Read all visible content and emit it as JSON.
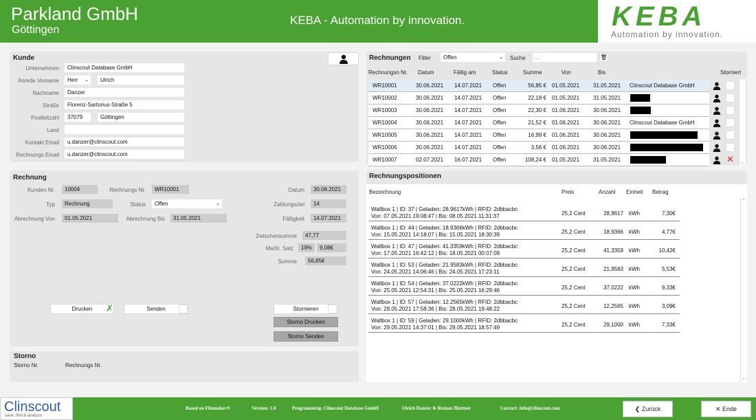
{
  "header": {
    "company": "Parkland GmbH",
    "city": "Göttingen",
    "tagline": "KEBA - Automation by innovation.",
    "logo_text": "KEBA",
    "logo_sub": "Automation by innovation."
  },
  "kunde": {
    "title": "Kunde",
    "unternehmen_label": "Unternehmen",
    "unternehmen": "Clinscout Database GmbH",
    "anrede_label": "Anrede Vorname",
    "anrede": "Herr",
    "vorname": "Ulrich",
    "nachname_label": "Nachname",
    "nachname": "Danzer",
    "strasse_label": "Straße",
    "strasse": "Florenz-Sartorius-Straße 5",
    "plz_label": "Postleitzahl",
    "plz": "37079",
    "ort": "Göttingen",
    "land_label": "Land",
    "land": "",
    "kontakt_label": "Kontakt Email",
    "kontakt": "u.danzer@clinscout.com",
    "rechnung_email_label": "Rechnungs Email",
    "rechnung_email": "u.danzer@clinscout.com"
  },
  "rechnung": {
    "title": "Rechnung",
    "kunden_nr_label": "Kunden Nr.",
    "kunden_nr": "10004",
    "rechnungs_nr_label": "Rechnungs Nr.",
    "rechnungs_nr": "WR10001",
    "datum_label": "Datum",
    "datum": "30.06.2021",
    "typ_label": "Typ",
    "typ": "Rechnung",
    "status_label": "Status",
    "status": "Offen",
    "zahlungsziel_label": "Zahlungsziel",
    "zahlungsziel": "14",
    "abrechnung_von_label": "Abrechnung Von",
    "abrechnung_von": "01.05.2021",
    "abrechnung_bis_label": "Abrechnung Bis",
    "abrechnung_bis": "31.05.2021",
    "faelligkeit_label": "Fälligkeit",
    "faelligkeit": "14.07.2021",
    "zwischensumme_label": "Zwischensumme",
    "zwischensumme": "47,77",
    "mwst_label": "MwSt. Satz",
    "mwst_satz": "19%",
    "mwst_betrag": "9,08€",
    "summe_label": "Summe",
    "summe": "56,85€",
    "drucken": "Drucken",
    "senden": "Senden",
    "stornieren": "Stornieren",
    "storno_drucken": "Storno Drucken",
    "storno_senden": "Storno Senden"
  },
  "storno": {
    "title": "Storno",
    "storno_nr": "Storno Nr.",
    "rechnungs_nr": "Rechnungs Nr."
  },
  "rechnungen": {
    "title": "Rechnungen",
    "filter_label": "Filter",
    "filter_value": "Offen",
    "suche_label": "Suche",
    "suche_placeholder": "...",
    "headers": {
      "nr": "Rechnungsn Nr.",
      "datum": "Datum",
      "faellig": "Fällig am",
      "status": "Status",
      "summe": "Summe",
      "von": "Von",
      "bis": "Bis",
      "storniert": "Storniert"
    },
    "rows": [
      {
        "nr": "WR10001",
        "datum": "30.06.2021",
        "faellig": "14.07.2021",
        "status": "Offen",
        "summe": "56,85 €",
        "von": "01.05.2021",
        "bis": "31.05.2021",
        "kunde": "Clinscout Database GmbH",
        "redact": 0,
        "storniert": false
      },
      {
        "nr": "WR10002",
        "datum": "30.06.2021",
        "faellig": "14.07.2021",
        "status": "Offen",
        "summe": "22,18 €",
        "von": "01.05.2021",
        "bis": "31.05.2021",
        "kunde": "",
        "redact": 29,
        "storniert": false
      },
      {
        "nr": "WR10003",
        "datum": "30.06.2021",
        "faellig": "14.07.2021",
        "status": "Offen",
        "summe": "22,30 €",
        "von": "01.06.2021",
        "bis": "30.06.2021",
        "kunde": "",
        "redact": 30,
        "storniert": false
      },
      {
        "nr": "WR10004",
        "datum": "30.06.2021",
        "faellig": "14.07.2021",
        "status": "Offen",
        "summe": "21,52 €",
        "von": "01.06.2021",
        "bis": "30.06.2021",
        "kunde": "Clinscout Database GmbH",
        "redact": 0,
        "storniert": false
      },
      {
        "nr": "WR10005",
        "datum": "30.06.2021",
        "faellig": "14.07.2021",
        "status": "Offen",
        "summe": "16,99 €",
        "von": "01.06.2021",
        "bis": "30.06.2021",
        "kunde": "",
        "redact": 98,
        "storniert": false
      },
      {
        "nr": "WR10006",
        "datum": "30.06.2021",
        "faellig": "14.07.2021",
        "status": "Offen",
        "summe": "3,56 €",
        "von": "01.06.2021",
        "bis": "30.06.2021",
        "kunde": "",
        "redact": 106,
        "storniert": false
      },
      {
        "nr": "WR10007",
        "datum": "02.07.2021",
        "faellig": "16.07.2021",
        "status": "Offen",
        "summe": "108,24 €",
        "von": "01.05.2021",
        "bis": "31.05.2021",
        "kunde": "",
        "redact": 52,
        "storniert": true
      }
    ]
  },
  "positionen": {
    "title": "Rechnungspositionen",
    "headers": {
      "bezeichnung": "Bezeichnung",
      "preis": "Preis",
      "anzahl": "Anzahl",
      "einheit": "Einheit",
      "betrag": "Betrag"
    },
    "rows": [
      {
        "l1": "Wallbox 1 | ID: 37 | Geladen: 28.9617kWh | RFID: 2dbbacbc",
        "l2": "Von: 07.05.2021 19:08:47 | Bis: 08.05.2021 11:31:37",
        "preis": "25,2 Cent",
        "anzahl": "28,9617",
        "einheit": "kWh",
        "betrag": "7,30€"
      },
      {
        "l1": "Wallbox 1 | ID: 44 | Geladen: 18.9366kWh | RFID: 2dbbacbc",
        "l2": "Von: 15.05.2021 14:18:07 | Bis: 15.05.2021 18:30:39",
        "preis": "25,2 Cent",
        "anzahl": "18,9366",
        "einheit": "kWh",
        "betrag": "4,77€"
      },
      {
        "l1": "Wallbox 1 | ID: 47 | Geladen: 41.3359kWh | RFID: 2dbbacbc",
        "l2": "Von: 17.05.2021 16:42:12 | Bis: 18.05.2021 00:07:09",
        "preis": "25,2 Cent",
        "anzahl": "41,3359",
        "einheit": "kWh",
        "betrag": "10,42€"
      },
      {
        "l1": "Wallbox 1 | ID: 53 | Geladen: 21.9583kWh | RFID: 2dbbacbc",
        "l2": "Von: 24.05.2021 14:06:46 | Bis: 24.05.2021 17:23:11",
        "preis": "25,2 Cent",
        "anzahl": "21,9583",
        "einheit": "kWh",
        "betrag": "5,53€"
      },
      {
        "l1": "Wallbox 1 | ID: 54 | Geladen: 37.0222kWh | RFID: 2dbbacbc",
        "l2": "Von: 25.05.2021 12:54:31 | Bis: 25.05.2021 16:29:46",
        "preis": "25,2 Cent",
        "anzahl": "37,0222",
        "einheit": "kWh",
        "betrag": "9,33€"
      },
      {
        "l1": "Wallbox 1 | ID: 57 | Geladen: 12.2565kWh | RFID: 2dbbacbc",
        "l2": "Von: 28.05.2021 17:58:36 | Bis: 28.05.2021 19:48:22",
        "preis": "25,2 Cent",
        "anzahl": "12,2565",
        "einheit": "kWh",
        "betrag": "3,09€"
      },
      {
        "l1": "Wallbox 1 | ID: 59 | Geladen: 29.1000kWh | RFID: 2dbbacbc",
        "l2": "Von: 29.05.2021 14:37:01 | Bis: 29.05.2021 18:57:49",
        "preis": "25,2 Cent",
        "anzahl": "29,1000",
        "einheit": "kWh",
        "betrag": "7,33€"
      }
    ]
  },
  "footer": {
    "logo": "Clinscout",
    "logo_sub": "save, find & analyze",
    "based": "Based on Filemaker®",
    "version": "Version:  1.0",
    "programming": "Programming:  Clinscout Database GmbH",
    "authors": "Ulrich Danzer & Roman Blattner",
    "contact": "Contact:  info@clinscout.com",
    "zurueck": "Zurück",
    "ende": "Ende"
  },
  "colors": {
    "brand_green": "#4aa232",
    "keba_gray": "#777777",
    "clinscout_blue": "#2b5fa6",
    "cancel_red": "#e02020"
  }
}
